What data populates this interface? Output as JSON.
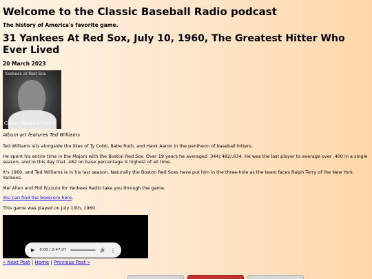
{
  "blog_title": "Welcome to the Classic Baseball Radio podcast",
  "blog_subtitle": "The history of America's favorite game.",
  "post_title": "31 Yankees At Red Sox, July 10, 1960, The Greatest Hitter Who Ever Lived",
  "post_date": "20 March 2023",
  "album_art": {
    "top_text": "Yankees at Red Sox",
    "bottom_text": "Classic Baseball Radio"
  },
  "album_caption": "Album art features Ted Williams",
  "paragraphs": {
    "p1": "Ted Williams sits alongside the likes of Ty Cobb, Babe Ruth, and Hank Aaron in the pantheon of baseball hitters.",
    "p2": "He spent his entire time in the Majors with the Boston Red Sox. Over 19 years he averaged .344/.482/.634. He was the last player to average over .400 in a single season, and to this day that .482 on base percentage is highest of all time.",
    "p3": "It's 1960, and Ted Williams is in his last season. Naturally the Boston Red Soxs have put him in the three-hole as the team faces Ralph Terry of the New York Yankees.",
    "p4": "Mel Allen and Phil Rizzuto for Yankees Radio take you through the game.",
    "p5_link": "You can find the boxscore here",
    "p5_after": ".",
    "p6": "This game was played on July 10th, 1960."
  },
  "audio_player": {
    "time": "0:00 / 2:47:07",
    "progress": 0,
    "icons": [
      "play-icon",
      "volume-icon",
      "more-options-icon"
    ]
  },
  "nav": {
    "next": "« Next Post",
    "sep1": " | ",
    "home": "Home",
    "sep2": " | ",
    "previous": "Previous Post »"
  },
  "colors": {
    "background_left": "#fff3e4",
    "background_right": "#ffd7aa",
    "link": "#0000ee"
  }
}
